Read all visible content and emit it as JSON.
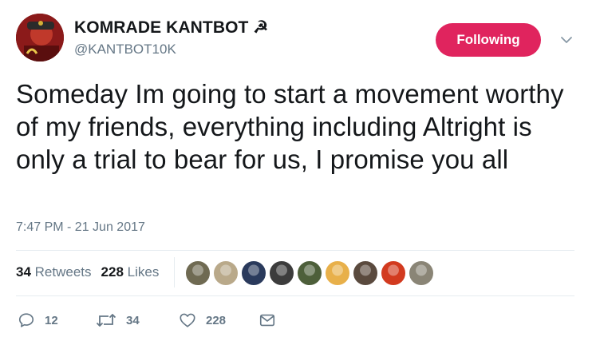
{
  "user": {
    "display_name": "KOMRADE KANTBOT ☭",
    "handle": "@KANTBOT10K",
    "follow_label": "Following"
  },
  "tweet": {
    "text": "Someday Im going to start a movement worthy of my friends, everything including Altright is only a trial to bear for us, I promise you all",
    "timestamp": "7:47 PM - 21 Jun 2017"
  },
  "stats": {
    "retweets_count": "34",
    "retweets_label": "Retweets",
    "likes_count": "228",
    "likes_label": "Likes"
  },
  "likers": [
    {
      "name": "liker-avatar-1",
      "color": "#6f6a52"
    },
    {
      "name": "liker-avatar-2",
      "color": "#b9a98a"
    },
    {
      "name": "liker-avatar-3",
      "color": "#2a3a5c"
    },
    {
      "name": "liker-avatar-4",
      "color": "#3c3c3c"
    },
    {
      "name": "liker-avatar-5",
      "color": "#4d5f3a"
    },
    {
      "name": "liker-avatar-6",
      "color": "#e8b04a"
    },
    {
      "name": "liker-avatar-7",
      "color": "#5a4a3e"
    },
    {
      "name": "liker-avatar-8",
      "color": "#d23a1f"
    },
    {
      "name": "liker-avatar-9",
      "color": "#8a8576"
    }
  ],
  "actions": {
    "reply_count": "12",
    "retweet_count": "34",
    "like_count": "228"
  },
  "colors": {
    "follow_button": "#e0245e",
    "secondary_text": "#657786",
    "primary_text": "#14171a",
    "divider": "#e6ecf0"
  },
  "icons": [
    "user-avatar",
    "chevron-down-icon",
    "reply-icon",
    "retweet-icon",
    "heart-icon",
    "message-icon"
  ]
}
